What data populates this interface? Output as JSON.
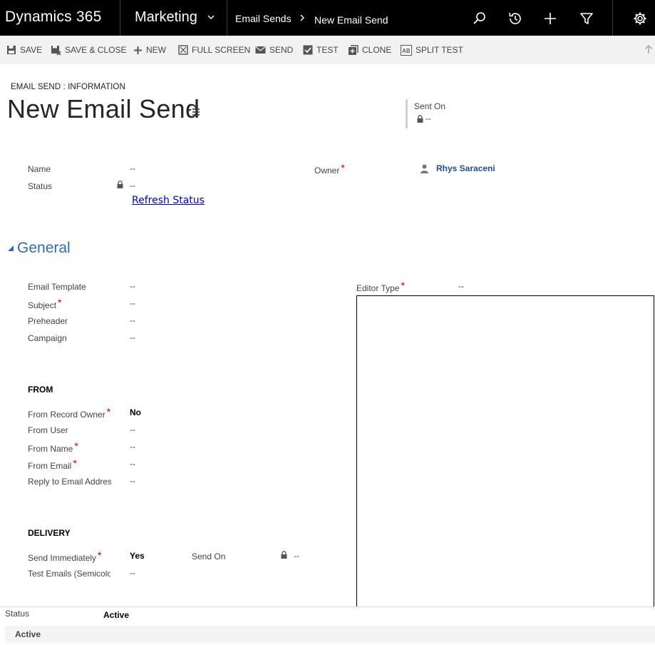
{
  "topnav": {
    "brand": "Dynamics 365",
    "app": "Marketing",
    "breadcrumb": [
      "Email Sends",
      "New Email Send"
    ]
  },
  "commands": {
    "save": "SAVE",
    "save_close": "SAVE & CLOSE",
    "new": "NEW",
    "full_screen": "FULL SCREEN",
    "send": "SEND",
    "test": "TEST",
    "clone": "CLONE",
    "split_test": "SPLIT TEST"
  },
  "header": {
    "entity_type": "EMAIL SEND : INFORMATION",
    "title": "New Email Send",
    "sent_on": {
      "label": "Sent On",
      "value": "--"
    }
  },
  "summary": {
    "name": {
      "label": "Name",
      "value": "--"
    },
    "status": {
      "label": "Status",
      "value": "--"
    },
    "refresh_link": "Refresh Status",
    "owner": {
      "label": "Owner",
      "value": "Rhys Saraceni"
    }
  },
  "general": {
    "title": "General",
    "fields": {
      "email_template": {
        "label": "Email Template",
        "value": "--"
      },
      "subject": {
        "label": "Subject",
        "value": "--"
      },
      "preheader": {
        "label": "Preheader",
        "value": "--"
      },
      "campaign": {
        "label": "Campaign",
        "value": "--"
      },
      "editor_type": {
        "label": "Editor Type",
        "value": "--"
      }
    },
    "from": {
      "title": "FROM",
      "from_record_owner": {
        "label": "From Record Owner",
        "value": "No"
      },
      "from_user": {
        "label": "From User",
        "value": "--"
      },
      "from_name": {
        "label": "From Name",
        "value": "--"
      },
      "from_email": {
        "label": "From Email",
        "value": "--"
      },
      "reply_to": {
        "label": "Reply to Email Addres",
        "value": "--"
      }
    },
    "delivery": {
      "title": "DELIVERY",
      "send_immediately": {
        "label": "Send Immediately",
        "value": "Yes"
      },
      "send_on": {
        "label": "Send On",
        "value": "--"
      },
      "test_emails": {
        "label": "Test Emails (Semicolon",
        "value": "--"
      }
    }
  },
  "footer": {
    "status_label": "Status",
    "status_value": "Active",
    "statusbar_text": "Active"
  },
  "colors": {
    "nav_bg": "#000000",
    "command_bar_bg": "#f2f2f2",
    "section_heading": "#2e6eb5",
    "owner_link": "#1f4e9c",
    "required": "#cc0000"
  }
}
